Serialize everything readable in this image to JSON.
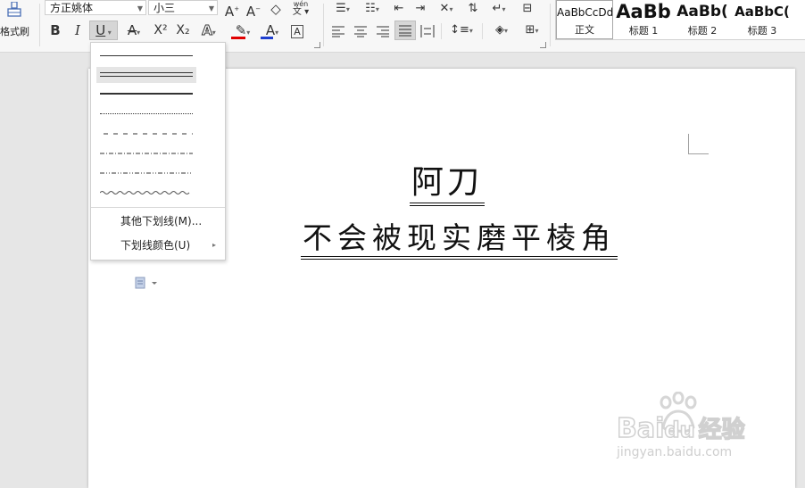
{
  "toolbar": {
    "format_painter_label": "格式刷",
    "font_name": "方正姚体",
    "font_size": "小三",
    "bold": "B",
    "italic": "I",
    "underline": "U",
    "superscript": "X²",
    "subscript": "X₂",
    "text_effect": "A",
    "highlight": "✎",
    "font_color": "A",
    "char_border": "A",
    "font_color_hex": "#d00000",
    "highlight_color_hex": "#e00000",
    "font_color_bar_hex": "#1f3fd0",
    "phonetic": "wén",
    "grow_font": "A",
    "shrink_font": "A",
    "clear_format": "◇"
  },
  "styles": {
    "items": [
      {
        "sample": "AaBbCcDd",
        "caption": "正文"
      },
      {
        "sample": "AaBb",
        "caption": "标题 1"
      },
      {
        "sample": "AaBb(",
        "caption": "标题 2"
      },
      {
        "sample": "AaBbC(",
        "caption": "标题 3"
      }
    ]
  },
  "underline_menu": {
    "other_underline": "其他下划线(M)...",
    "underline_color": "下划线颜色(U)",
    "submenu_arrow": "▸"
  },
  "document": {
    "title": "阿刀",
    "subtitle": "不会被现实磨平棱角"
  },
  "watermark": {
    "brand": "Bai",
    "brand2": "du",
    "cn": "经验",
    "url": "jingyan.baidu.com"
  }
}
